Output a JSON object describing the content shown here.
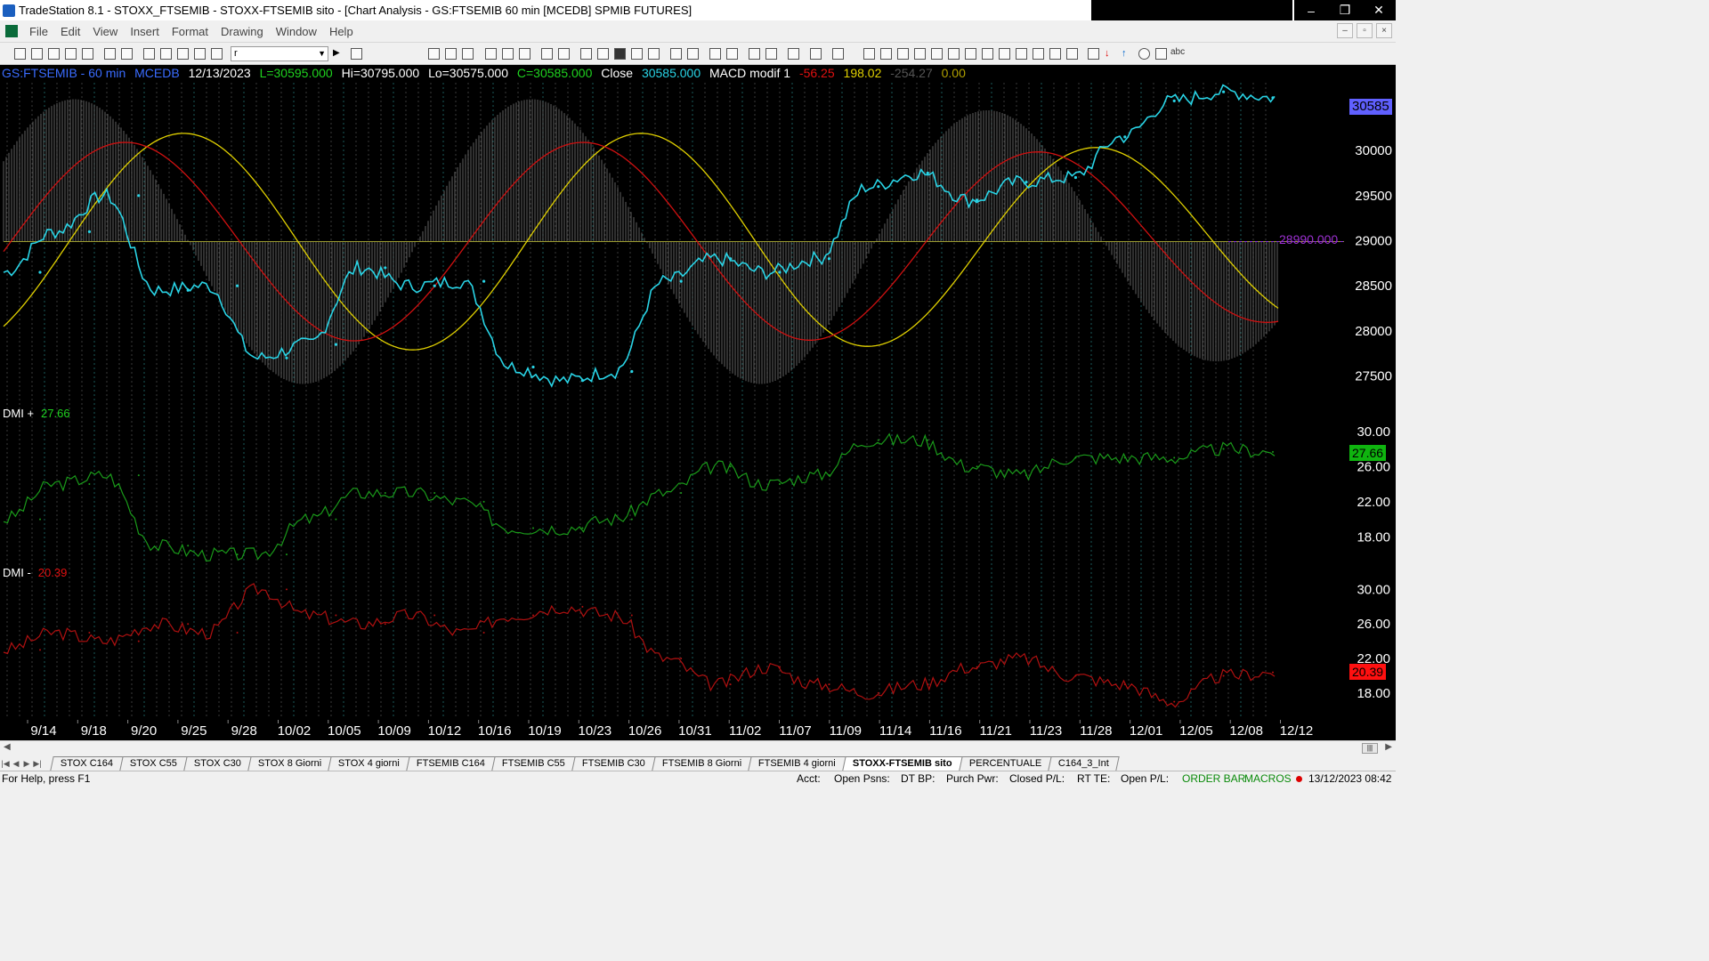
{
  "window": {
    "title": "TradeStation 8.1 - STOXX_FTSEMIB - STOXX-FTSEMIB sito - [Chart Analysis - GS:FTSEMIB  60 min  [MCEDB] SPMIB FUTURES]",
    "controls": [
      "–",
      "❐",
      "✕"
    ]
  },
  "menu": [
    "File",
    "Edit",
    "View",
    "Insert",
    "Format",
    "Drawing",
    "Window",
    "Help"
  ],
  "mdi_controls": [
    "–",
    "▫",
    "×"
  ],
  "toolbar": {
    "combo_value": "r",
    "text_tool": "abc"
  },
  "chart_header": {
    "symbol": "GS:FTSEMIB - 60 min",
    "exchange": "MCEDB",
    "date": "12/13/2023",
    "low_open": "L=30595.000",
    "high": "Hi=30795.000",
    "low": "Lo=30575.000",
    "close": "C=30585.000",
    "close_label": "Close",
    "close_value": "30585.000",
    "indicator": "MACD modif 1",
    "ind_v1": "-56.25",
    "ind_v2": "198.02",
    "ind_v3": "-254.27",
    "ind_v4": "0.00"
  },
  "price_panel": {
    "y_ticks": [
      "30000",
      "29500",
      "29000",
      "28500",
      "28000",
      "27500"
    ],
    "last_price": "30585",
    "ref_line_label": "28990.000"
  },
  "dmi_plus": {
    "label": "DMI +",
    "value": "27.66",
    "y_ticks": [
      "30.00",
      "26.00",
      "22.00",
      "18.00"
    ]
  },
  "dmi_minus": {
    "label": "DMI -",
    "value": "20.39",
    "y_ticks": [
      "30.00",
      "26.00",
      "22.00",
      "18.00"
    ]
  },
  "x_axis": [
    "9/14",
    "9/18",
    "9/20",
    "9/25",
    "9/28",
    "10/02",
    "10/05",
    "10/09",
    "10/12",
    "10/16",
    "10/19",
    "10/23",
    "10/26",
    "10/31",
    "11/02",
    "11/07",
    "11/09",
    "11/14",
    "11/16",
    "11/21",
    "11/23",
    "11/28",
    "12/01",
    "12/05",
    "12/08",
    "12/12"
  ],
  "tabs": [
    "STOX C164",
    "STOX C55",
    "STOX  C30",
    "STOX  8 Giorni",
    "STOX 4 giorni",
    "FTSEMIB C164",
    "FTSEMIB C55",
    "FTSEMIB C30",
    "FTSEMIB  8 Giorni",
    "FTSEMIB  4 giorni",
    "STOXX-FTSEMIB sito",
    "PERCENTUALE",
    "C164_3_Int"
  ],
  "active_tab": "STOXX-FTSEMIB sito",
  "status": {
    "help": "For Help, press F1",
    "acct": "Acct:",
    "open_psns": "Open Psns:",
    "dt_bp": "DT BP:",
    "purch_pwr": "Purch Pwr:",
    "closed_pl": "Closed P/L:",
    "rt_te": "RT TE:",
    "open_pl": "Open P/L:",
    "order_bar": "ORDER BAR",
    "macros": "MACROS",
    "datetime": "13/12/2023 08:42"
  },
  "chart_data": {
    "type": "line",
    "price_series": [
      {
        "x": "9/14",
        "close": 28650
      },
      {
        "x": "9/18",
        "close": 29100
      },
      {
        "x": "9/20",
        "close": 29500
      },
      {
        "x": "9/25",
        "close": 28450
      },
      {
        "x": "9/28",
        "close": 28500
      },
      {
        "x": "10/02",
        "close": 27700
      },
      {
        "x": "10/05",
        "close": 27850
      },
      {
        "x": "10/09",
        "close": 28700
      },
      {
        "x": "10/12",
        "close": 28500
      },
      {
        "x": "10/16",
        "close": 28550
      },
      {
        "x": "10/19",
        "close": 27600
      },
      {
        "x": "10/23",
        "close": 27450
      },
      {
        "x": "10/26",
        "close": 27550
      },
      {
        "x": "10/31",
        "close": 28550
      },
      {
        "x": "11/02",
        "close": 28800
      },
      {
        "x": "11/07",
        "close": 28650
      },
      {
        "x": "11/09",
        "close": 28800
      },
      {
        "x": "11/14",
        "close": 29600
      },
      {
        "x": "11/16",
        "close": 29750
      },
      {
        "x": "11/21",
        "close": 29450
      },
      {
        "x": "11/23",
        "close": 29650
      },
      {
        "x": "11/28",
        "close": 29700
      },
      {
        "x": "12/01",
        "close": 30150
      },
      {
        "x": "12/05",
        "close": 30550
      },
      {
        "x": "12/08",
        "close": 30650
      },
      {
        "x": "12/12",
        "close": 30585
      }
    ],
    "ylim": [
      27200,
      30800
    ],
    "reference_line": 28990,
    "dmi_plus": [
      20,
      24,
      25,
      17,
      16,
      16,
      20,
      23,
      23,
      22,
      19,
      19,
      20,
      23,
      26,
      24,
      25,
      29,
      29,
      26,
      25,
      27,
      27,
      27,
      28,
      27.66
    ],
    "dmi_minus": [
      23,
      25,
      24,
      26,
      25,
      30,
      27,
      26,
      27,
      25,
      27,
      28,
      27,
      22,
      19,
      21,
      19,
      18,
      19,
      21,
      22,
      20,
      19,
      17,
      20,
      20.39
    ],
    "dmi_ylim": [
      15,
      32
    ],
    "colors": {
      "price": "#29d4e6",
      "macd_slow": "#e0d000",
      "macd_fast": "#d01010",
      "histogram": "#6e6e6e",
      "dmi_plus": "#1a9a1a",
      "dmi_minus": "#b01010",
      "last_price_bg": "#6060ff",
      "ref_line": "#8a2be2"
    }
  }
}
